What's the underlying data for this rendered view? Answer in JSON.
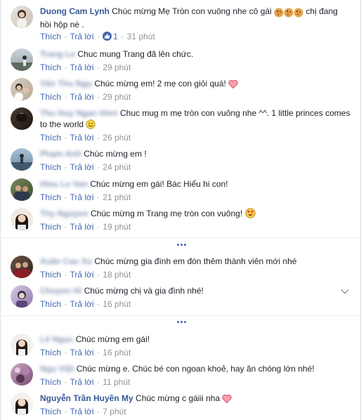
{
  "actions": {
    "like": "Thích",
    "reply": "Trả lời",
    "separator": "·"
  },
  "comments": [
    {
      "author": "Duong Cam Lynh",
      "text": "Chúc mừng Mẹ Tròn con vuông nhe cô gái",
      "text2": "chị đang hồi hộp nè .",
      "like_count": "1",
      "time": "31 phút",
      "emoji": "cookie-icon"
    },
    {
      "author": "Trang Le",
      "text": "Chuc mung Trang đã lên chức.",
      "time": "29 phút"
    },
    {
      "author": "Vân Thu Ngọ",
      "text": "Chúc mừng em! 2 mẹ con giỏi quá!",
      "time": "29 phút",
      "emoji": "heart-icon"
    },
    {
      "author": "Thu Huy Ngan Hien",
      "text": "Chuc mug m mẹ tròn con vuông nhe ^^. 1 little princes",
      "text2": "comes to the world",
      "time": "26 phút",
      "emoji": "smile-icon"
    },
    {
      "author": "Phạm Anh",
      "text": "Chúc mừng em !",
      "time": "24 phút"
    },
    {
      "author": "Hieu Le Van",
      "text": "Chúc mừng em gái! Bác Hiểu hi con!",
      "time": "21 phút"
    },
    {
      "author": "Thy Nguyen",
      "text": "Chúc mừng m Trang mẹ tròn con vuông!",
      "time": "19 phút",
      "emoji": "heart-eyes-icon"
    },
    {
      "author": "Xuân Cao Xu",
      "text": "Chúc mừng gia đình em đón thêm thành viên mới nhé",
      "time": "18 phút"
    },
    {
      "author": "Chuyen Hi",
      "text": "Chúc mừng chị và gia đình nhé!",
      "time": "16 phút"
    },
    {
      "author": "Lê Ngọc",
      "text": "Chúc mừng em gái!",
      "time": "16 phút"
    },
    {
      "author": "Ngọ Việt",
      "text": "Chúc mừng e. Chúc bé con ngoan khoẻ, hay ăn chóng lớn nhé!",
      "time": "11 phút"
    },
    {
      "author": "Nguyễn Trần Huyền My",
      "text": "Chúc mừng c gáiii nha",
      "time": "7 phút",
      "emoji": "heart-icon"
    }
  ],
  "colors": {
    "link": "#365899",
    "action": "#4267b2",
    "meta": "#90949c",
    "text": "#1d2129"
  }
}
